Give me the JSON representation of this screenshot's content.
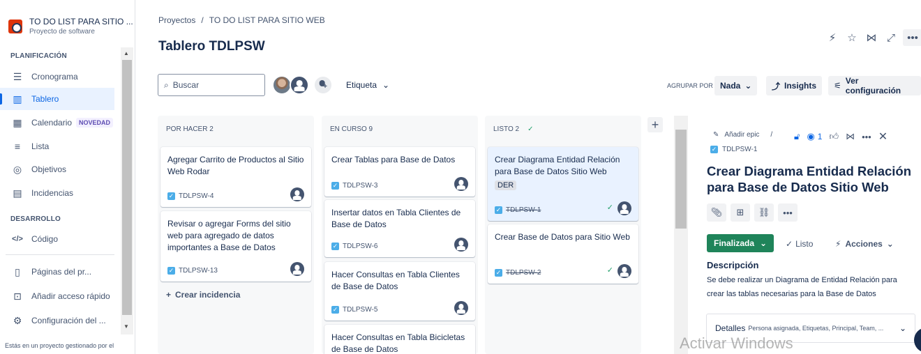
{
  "project": {
    "title": "TO DO LIST PARA SITIO ...",
    "subtitle": "Proyecto de software"
  },
  "sidebar": {
    "planning_label": "PLANIFICACIÓN",
    "items": [
      {
        "label": "Cronograma",
        "icon": "timeline-icon"
      },
      {
        "label": "Tablero",
        "icon": "board-icon"
      },
      {
        "label": "Calendario",
        "icon": "calendar-icon",
        "badge": "NOVEDAD"
      },
      {
        "label": "Lista",
        "icon": "list-icon"
      },
      {
        "label": "Objetivos",
        "icon": "target-icon"
      },
      {
        "label": "Incidencias",
        "icon": "issues-icon"
      }
    ],
    "dev_label": "DESARROLLO",
    "dev_items": [
      {
        "label": "Código",
        "icon": "code-icon"
      }
    ],
    "bottom_items": [
      {
        "label": "Páginas del pr...",
        "icon": "page-icon"
      },
      {
        "label": "Añadir acceso rápido",
        "icon": "shortcut-icon"
      },
      {
        "label": "Configuración del ...",
        "icon": "gear-icon"
      }
    ],
    "footer": "Estás en un proyecto gestionado por el"
  },
  "breadcrumb": {
    "root": "Proyectos",
    "sep": "/",
    "current": "TO DO LIST PARA SITIO WEB"
  },
  "page_title": "Tablero TDLPSW",
  "toolbar": {
    "search_placeholder": "Buscar",
    "label_filter": "Etiqueta",
    "group_by_label": "AGRUPAR POR",
    "group_by_value": "Nada",
    "insights": "Insights",
    "view_settings": "Ver configuración"
  },
  "columns": [
    {
      "title": "POR HACER 2",
      "cards": [
        {
          "title": "Agregar Carrito de Productos al Sitio Web Rodar",
          "key": "TDLPSW-4"
        },
        {
          "title": "Revisar o agregar Forms del sitio web para agregado de datos importantes a Base de Datos",
          "key": "TDLPSW-13"
        }
      ],
      "create": "Crear incidencia"
    },
    {
      "title": "EN CURSO 9",
      "cards": [
        {
          "title": "Crear Tablas para Base de Datos",
          "key": "TDLPSW-3"
        },
        {
          "title": "Insertar datos en Tabla Clientes de Base de Datos",
          "key": "TDLPSW-6"
        },
        {
          "title": "Hacer Consultas en Tabla Clientes de Base de Datos",
          "key": "TDLPSW-5"
        },
        {
          "title": "Hacer Consultas en Tabla Bicicletas de Base de Datos",
          "key": ""
        }
      ]
    },
    {
      "title": "LISTO 2",
      "cards": [
        {
          "title": "Crear Diagrama Entidad Relación para Base de Datos Sitio Web",
          "key": "TDLPSW-1",
          "tag": "DER"
        },
        {
          "title": "Crear Base de Datos para Sitio Web",
          "key": "TDLPSW-2"
        }
      ]
    }
  ],
  "detail": {
    "add_epic": "Añadir epic",
    "slash": "/",
    "key": "TDLPSW-1",
    "watchers": "1",
    "title": "Crear Diagrama Entidad Relación para Base de Datos Sitio Web",
    "status": "Finalizada",
    "resolution": "Listo",
    "actions": "Acciones",
    "description_heading": "Descripción",
    "description": "Se debe realizar un Diagrama de Entidad Relación para crear las tablas necesarias para la Base de Datos",
    "details_label": "Detalles",
    "details_fields": "Persona asignada, Etiquetas, Principal, Team, ..."
  },
  "watermark": "Activar Windows",
  "colors": {
    "accent": "#0c66e4",
    "done_green": "#1f845a",
    "issue_blue": "#4bade8"
  }
}
